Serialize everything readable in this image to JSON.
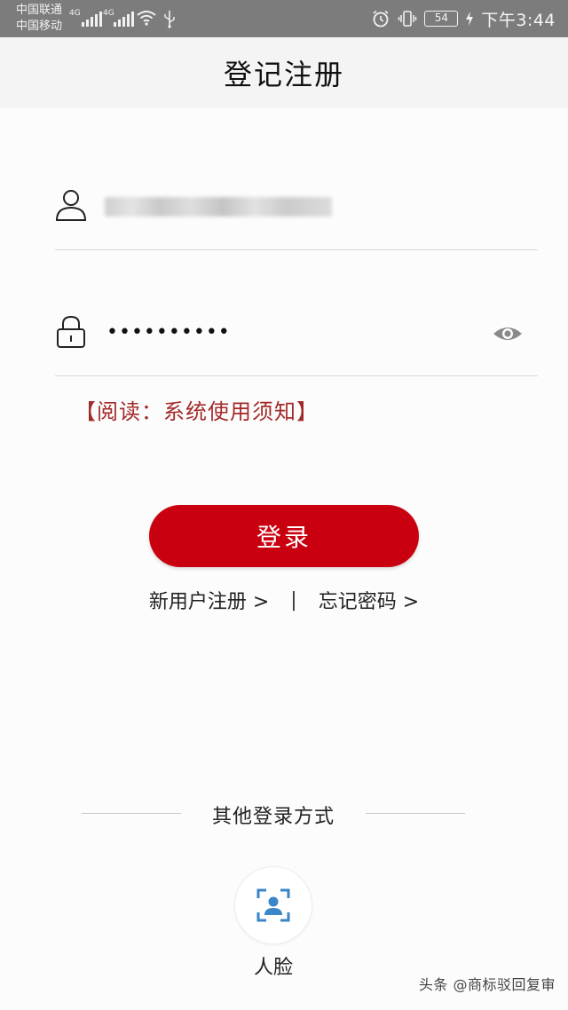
{
  "status_bar": {
    "carrier_1": "中国联通",
    "carrier_2": "中国移动",
    "network_1": "4G",
    "network_2": "4G",
    "battery": "54",
    "time": "下午3:44",
    "icons": [
      "signal-icon",
      "signal-icon",
      "wifi-icon",
      "usb-icon",
      "alarm-icon",
      "vibrate-icon",
      "battery-icon",
      "charging-icon"
    ]
  },
  "header": {
    "title": "登记注册"
  },
  "form": {
    "username_icon": "user-icon",
    "password_icon": "lock-icon",
    "password_value": "••••••••••",
    "password_toggle_icon": "eye-icon",
    "notice": "【阅读：系统使用须知】",
    "login_label": "登录"
  },
  "links": {
    "register": "新用户注册 >",
    "separator": "|",
    "forgot": "忘记密码 >"
  },
  "other_login": {
    "title": "其他登录方式",
    "face_label": "人脸",
    "face_icon": "face-recognition-icon"
  },
  "watermark": "头条 @商标驳回复审",
  "colors": {
    "status_bar_bg": "#7c7c7c",
    "title_bar_bg": "#f4f4f4",
    "primary_red": "#c8000f",
    "notice_red": "#a32a2a",
    "face_icon_blue": "#3a86c8"
  }
}
